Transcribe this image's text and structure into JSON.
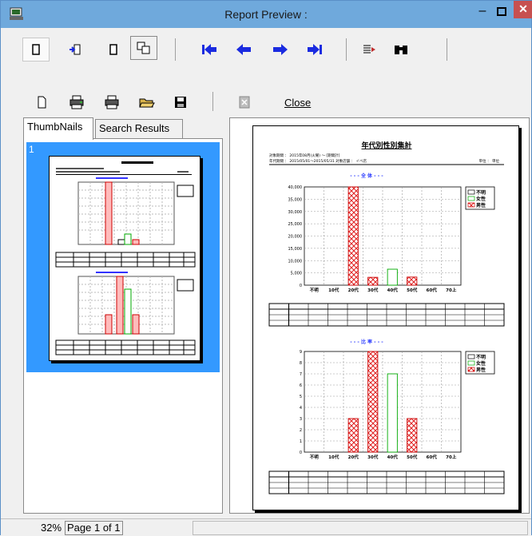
{
  "window": {
    "title": "Report Preview :",
    "minimize_glyph": "–",
    "close_glyph": "✕"
  },
  "toolbar": {
    "close_label": "Close"
  },
  "tabs": [
    {
      "label": "ThumbNails"
    },
    {
      "label": "Search Results"
    }
  ],
  "thumbnail": {
    "number": "1"
  },
  "status": {
    "zoom": "32%",
    "page": "Page 1 of 1"
  },
  "colors": {
    "titlebar": "#6fa9dc",
    "close": "#c75050",
    "selection": "#3399ff",
    "nav_arrow": "#1a2be0"
  },
  "icons": [
    "app-icon",
    "single-page-icon",
    "two-page-icon",
    "page-width-icon",
    "multi-page-icon",
    "first-page-icon",
    "previous-page-icon",
    "next-page-icon",
    "last-page-icon",
    "goto-page-icon",
    "binoculars-icon",
    "new-page-icon",
    "printer-setup-icon",
    "printer-icon",
    "open-folder-icon",
    "save-icon",
    "export-icon"
  ],
  "report": {
    "title": "年代別性別集計",
    "header_lines": [
      "対象期間 ： 2015年08月(火曜) ～ [期間計]",
      "年代期間 ： 2015/05/01～2015/05/31  対象店舗 ： イベ店"
    ],
    "unit": "単位 ： 単位",
    "chart1_title": "- - - 全 体 - - -",
    "chart2_title": "- - - 比 率 - - -"
  },
  "chart_data": [
    {
      "type": "bar",
      "title": "- - - 全 体 - - -",
      "categories": [
        "不明",
        "10代",
        "20代",
        "30代",
        "40代",
        "50代",
        "60代",
        "70上"
      ],
      "series": [
        {
          "name": "不明",
          "values": [
            0,
            0,
            0,
            0,
            0,
            0,
            0,
            0
          ]
        },
        {
          "name": "女性",
          "values": [
            0,
            0,
            0,
            0,
            6500,
            0,
            0,
            0
          ]
        },
        {
          "name": "男性",
          "values": [
            0,
            0,
            41000,
            3200,
            0,
            3300,
            0,
            0
          ]
        }
      ],
      "yticks": [
        "0",
        "5,000",
        "10,000",
        "15,000",
        "20,000",
        "25,000",
        "30,000",
        "35,000",
        "40,000"
      ],
      "ylim": [
        0,
        40000
      ],
      "legend": "right"
    },
    {
      "type": "bar",
      "title": "- - - 比 率 - - -",
      "categories": [
        "不明",
        "10代",
        "20代",
        "30代",
        "40代",
        "50代",
        "60代",
        "70上"
      ],
      "series": [
        {
          "name": "不明",
          "values": [
            0,
            0,
            0,
            0,
            0,
            0,
            0,
            0
          ]
        },
        {
          "name": "女性",
          "values": [
            0,
            0,
            0,
            0,
            7,
            0,
            0,
            0
          ]
        },
        {
          "name": "男性",
          "values": [
            0,
            0,
            3,
            9,
            0,
            3,
            0,
            0
          ]
        }
      ],
      "yticks": [
        "0",
        "1",
        "2",
        "3",
        "4",
        "5",
        "6",
        "7",
        "8",
        "9"
      ],
      "ylim": [
        0,
        9
      ],
      "legend": "right"
    }
  ]
}
